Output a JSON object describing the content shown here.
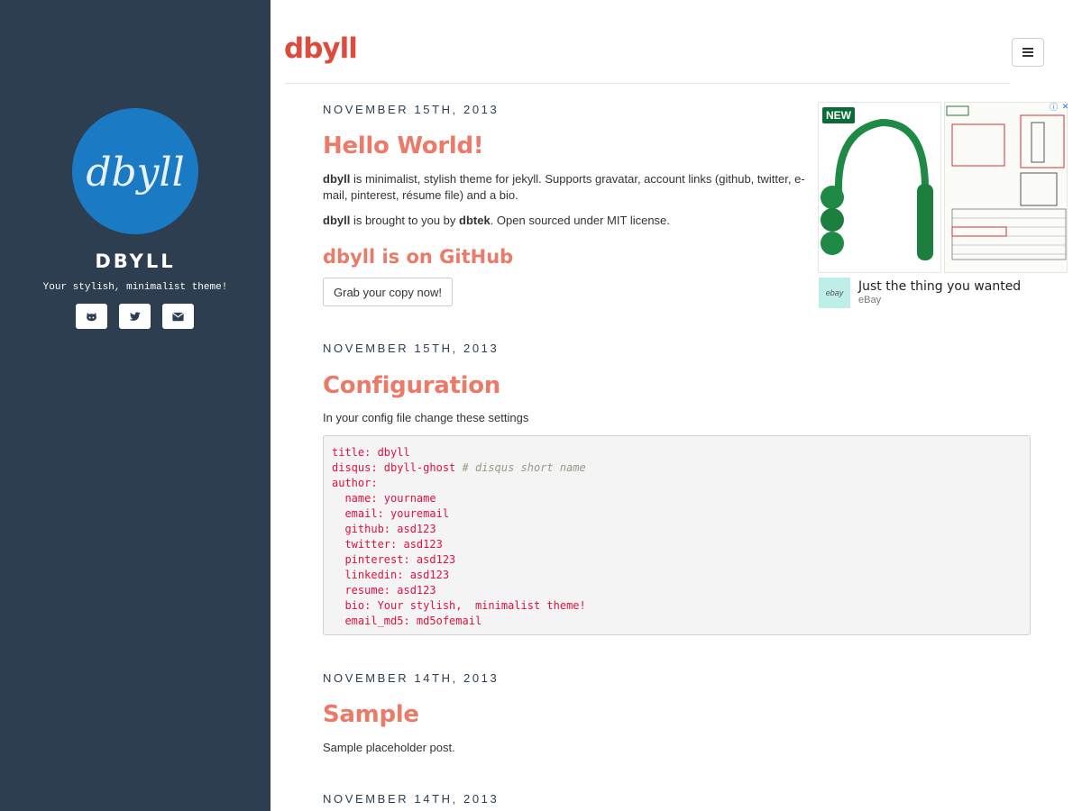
{
  "sidebar": {
    "avatar_text": "dbyll",
    "site_name": "DBYLL",
    "tagline": "Your stylish, minimalist theme!",
    "social": [
      {
        "icon": "github-icon"
      },
      {
        "icon": "twitter-icon"
      },
      {
        "icon": "envelope-icon"
      }
    ],
    "colors": {
      "background": "#2c3e50",
      "avatar": "#1a7bc4"
    }
  },
  "header": {
    "brand": "dbyll",
    "menu_icon": "hamburger-icon",
    "colors": {
      "brand": "#dc4b3c"
    }
  },
  "posts": [
    {
      "date": "NOVEMBER 15TH, 2013",
      "title": "Hello World!",
      "p1_bold": "dbyll",
      "p1_rest": " is minimalist, stylish theme for jekyll. Supports gravatar, account links (github, twitter, e-mail, pinterest, résume file) and a bio.",
      "p2_bold": "dbyll",
      "p2_mid": " is brought to you by ",
      "p2_bold2": "dbtek",
      "p2_end": ". Open sourced under MIT license.",
      "subheading": "dbyll is on GitHub",
      "button": "Grab your copy now!"
    },
    {
      "date": "NOVEMBER 15TH, 2013",
      "title": "Configuration",
      "text": "In your config file change these settings",
      "code": [
        "title: dbyll",
        "disqus: dbyll-ghost",
        "author:",
        "  name: yourname",
        "  email: youremail",
        "  github: asd123",
        "  twitter: asd123",
        "  pinterest: asd123",
        "  linkedin: asd123",
        "  resume: asd123",
        "  bio: Your stylish,  minimalist theme!",
        "  email_md5: md5ofemail"
      ],
      "code_comment": "# disqus short name"
    },
    {
      "date": "NOVEMBER 14TH, 2013",
      "title": "Sample",
      "text": "Sample placeholder post."
    },
    {
      "date": "NOVEMBER 14TH, 2013"
    }
  ],
  "ad": {
    "badge": "NEW",
    "title": "Just the thing you wanted",
    "source": "eBay",
    "logo_text": "ebay"
  },
  "colors": {
    "title": "#ec7a69",
    "code_text": "#dd1144",
    "code_bg": "#f4f4f4"
  }
}
